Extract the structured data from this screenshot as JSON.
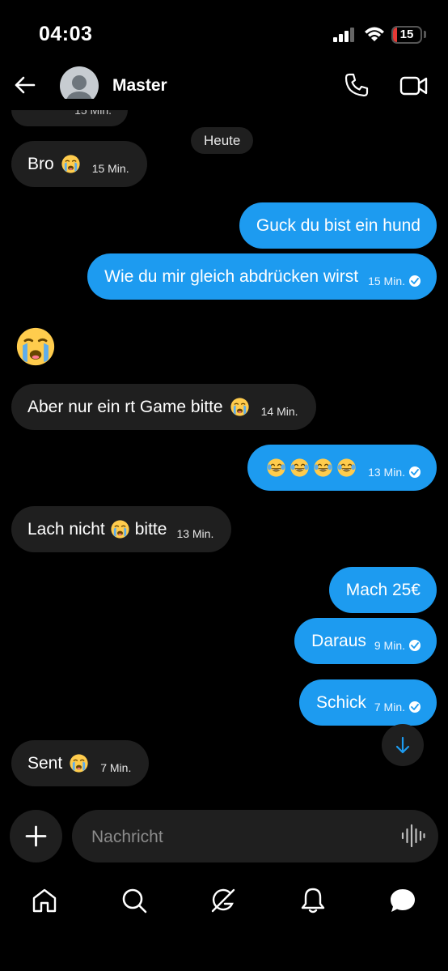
{
  "status_bar": {
    "time": "04:03",
    "battery": "15",
    "battery_level": 0.15,
    "battery_color": "#e53935"
  },
  "header": {
    "contact_name": "Master",
    "icons": [
      "back-arrow-icon",
      "phone-icon",
      "video-camera-icon"
    ]
  },
  "chat": {
    "clipped_time": "15 Min.",
    "date_divider": "Heute",
    "messages": [
      {
        "dir": "in",
        "text": "Bro",
        "emoji_after": "loudly-crying-face",
        "time": "15 Min."
      },
      {
        "dir": "out",
        "text": "Guck du bist ein hund",
        "time": ""
      },
      {
        "dir": "out",
        "text": "Wie du mir gleich abdrücken wirst",
        "time": "15 Min.",
        "read": true
      },
      {
        "dir": "in",
        "big_emoji": "loudly-crying-face"
      },
      {
        "dir": "in",
        "text": "Aber nur ein rt Game bitte",
        "emoji_after": "loudly-crying-face",
        "time": "14 Min."
      },
      {
        "dir": "out",
        "emojis": [
          "face-with-tears-of-joy",
          "face-with-tears-of-joy",
          "face-with-tears-of-joy",
          "face-with-tears-of-joy"
        ],
        "time": "13 Min.",
        "read": true
      },
      {
        "dir": "in",
        "text": "Lach nicht",
        "emoji_mid": "loudly-crying-face",
        "text_after": "bitte",
        "time": "13 Min."
      },
      {
        "dir": "out",
        "text": "Mach 25€",
        "time": ""
      },
      {
        "dir": "out",
        "text": "Daraus",
        "time": "9 Min.",
        "read": true
      },
      {
        "dir": "out",
        "text": "Schick",
        "time": "7 Min.",
        "read": true
      },
      {
        "dir": "in",
        "text": "Sent",
        "emoji_after": "loudly-crying-face",
        "time": "7 Min."
      }
    ]
  },
  "composer": {
    "placeholder": "Nachricht"
  },
  "bottom_nav": [
    "home-icon",
    "search-icon",
    "grok-icon",
    "notifications-bell-icon",
    "messages-icon"
  ],
  "colors": {
    "background": "#000000",
    "incoming_bubble": "#1f1f1f",
    "outgoing_bubble": "#1d9bf0",
    "muted_text": "#8b8b8b"
  }
}
